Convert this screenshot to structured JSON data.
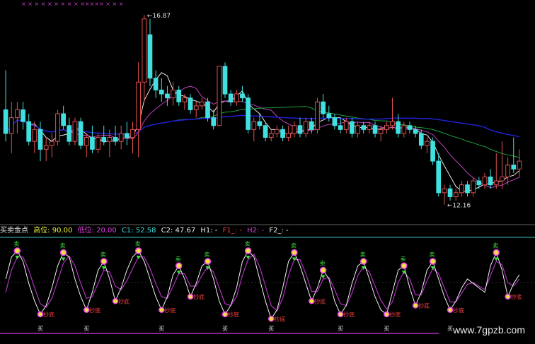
{
  "colors": {
    "background": "#000000",
    "candle_up": "#e05050",
    "candle_down": "#40e0e0",
    "ma_white": "#e8e8e8",
    "ma_magenta": "#c040c0",
    "ma_green": "#20a040",
    "ma_blue": "#2020d0",
    "kdj_white": "#f0f0f0",
    "kdj_magenta": "#b030c0",
    "grid_cyan": "#40c0c0"
  },
  "top_strip": {
    "x_marks": "×    × ×     × ×  ×  × ×   ×        ×××××   × ×   ×"
  },
  "annotations": {
    "high_label": "16.87",
    "low_label": "12.16"
  },
  "indicator_header": {
    "name": "买卖金点",
    "high_level": "高位: 90.00",
    "low_level": "低位: 20.00",
    "c1": "C1: 52.58",
    "c2": "C2: 47.67",
    "h1": "H1: -",
    "f1": "F1_: -",
    "h2": "H2: -",
    "f2": "F2_: -"
  },
  "signals": {
    "buy_label": "买",
    "sell_label": "卖",
    "bottom_label": "抄底"
  },
  "watermark": "www.7gpzb.com",
  "chart_data": {
    "type": "candlestick",
    "price_range": [
      11.8,
      17.2
    ],
    "candles": [
      [
        14.6,
        15.6,
        13.8,
        14.0
      ],
      [
        14.0,
        14.8,
        13.5,
        14.4
      ],
      [
        14.4,
        14.8,
        14.0,
        14.6
      ],
      [
        14.6,
        14.8,
        14.1,
        14.3
      ],
      [
        14.3,
        14.5,
        13.7,
        13.8
      ],
      [
        13.8,
        14.3,
        13.5,
        14.1
      ],
      [
        14.1,
        14.3,
        13.3,
        13.6
      ],
      [
        13.6,
        13.9,
        13.3,
        13.7
      ],
      [
        13.7,
        14.0,
        13.4,
        13.8
      ],
      [
        13.8,
        14.6,
        13.7,
        14.5
      ],
      [
        14.5,
        14.7,
        14.1,
        14.2
      ],
      [
        14.2,
        14.4,
        13.7,
        13.8
      ],
      [
        13.8,
        14.4,
        13.7,
        14.3
      ],
      [
        14.3,
        14.4,
        13.6,
        13.7
      ],
      [
        13.7,
        14.0,
        13.4,
        13.9
      ],
      [
        13.9,
        14.2,
        13.5,
        13.6
      ],
      [
        13.6,
        14.0,
        13.5,
        13.9
      ],
      [
        13.9,
        14.2,
        13.7,
        13.8
      ],
      [
        13.8,
        14.1,
        13.4,
        13.9
      ],
      [
        13.9,
        14.2,
        13.7,
        13.8
      ],
      [
        13.8,
        14.2,
        13.6,
        14.0
      ],
      [
        14.0,
        14.3,
        13.7,
        13.9
      ],
      [
        13.9,
        14.3,
        13.5,
        14.1
      ],
      [
        14.1,
        15.8,
        13.4,
        15.3
      ],
      [
        15.3,
        17.0,
        14.8,
        16.9
      ],
      [
        16.5,
        16.9,
        15.2,
        15.4
      ],
      [
        15.4,
        15.6,
        14.9,
        15.1
      ],
      [
        15.1,
        15.4,
        14.8,
        15.0
      ],
      [
        15.0,
        15.2,
        14.7,
        14.9
      ],
      [
        14.9,
        15.3,
        14.7,
        15.1
      ],
      [
        15.1,
        15.2,
        14.7,
        14.8
      ],
      [
        14.8,
        15.0,
        14.6,
        14.9
      ],
      [
        14.9,
        15.0,
        14.5,
        14.6
      ],
      [
        14.6,
        14.8,
        14.4,
        14.7
      ],
      [
        14.7,
        14.9,
        14.6,
        14.8
      ],
      [
        14.8,
        14.9,
        14.3,
        14.4
      ],
      [
        14.4,
        14.6,
        14.1,
        14.2
      ],
      [
        14.2,
        15.7,
        14.2,
        15.7
      ],
      [
        15.7,
        15.8,
        14.9,
        15.0
      ],
      [
        15.0,
        15.1,
        14.7,
        14.8
      ],
      [
        14.8,
        15.1,
        14.7,
        15.0
      ],
      [
        15.0,
        15.2,
        14.8,
        14.9
      ],
      [
        14.9,
        15.0,
        14.0,
        14.1
      ],
      [
        14.1,
        14.4,
        13.8,
        14.3
      ],
      [
        14.3,
        14.5,
        14.1,
        14.2
      ],
      [
        14.2,
        14.3,
        13.8,
        13.9
      ],
      [
        13.9,
        14.1,
        13.8,
        14.0
      ],
      [
        14.0,
        14.2,
        13.9,
        14.1
      ],
      [
        14.1,
        14.2,
        13.8,
        13.9
      ],
      [
        13.9,
        14.2,
        13.8,
        14.0
      ],
      [
        14.0,
        14.3,
        13.9,
        14.2
      ],
      [
        14.2,
        14.4,
        13.9,
        14.0
      ],
      [
        14.0,
        14.4,
        13.9,
        14.3
      ],
      [
        14.3,
        14.4,
        14.0,
        14.1
      ],
      [
        14.1,
        14.9,
        14.0,
        14.8
      ],
      [
        14.8,
        15.0,
        14.4,
        14.5
      ],
      [
        14.5,
        14.7,
        14.3,
        14.4
      ],
      [
        14.4,
        14.5,
        14.1,
        14.2
      ],
      [
        14.2,
        14.4,
        14.0,
        14.1
      ],
      [
        14.1,
        14.4,
        14.0,
        14.3
      ],
      [
        14.3,
        14.4,
        13.9,
        14.0
      ],
      [
        14.0,
        14.3,
        13.9,
        14.2
      ],
      [
        14.2,
        14.3,
        14.0,
        14.1
      ],
      [
        14.1,
        14.3,
        14.0,
        14.2
      ],
      [
        14.2,
        14.3,
        13.9,
        14.0
      ],
      [
        14.0,
        14.2,
        13.8,
        14.1
      ],
      [
        14.1,
        14.3,
        14.0,
        14.2
      ],
      [
        14.2,
        14.9,
        14.1,
        14.3
      ],
      [
        14.3,
        14.5,
        13.9,
        14.0
      ],
      [
        14.0,
        14.3,
        13.9,
        14.2
      ],
      [
        14.2,
        14.3,
        14.0,
        14.1
      ],
      [
        14.1,
        14.2,
        13.9,
        14.0
      ],
      [
        14.0,
        14.1,
        13.6,
        13.7
      ],
      [
        13.7,
        13.9,
        13.5,
        13.8
      ],
      [
        13.8,
        13.9,
        13.2,
        13.3
      ],
      [
        13.3,
        13.5,
        12.4,
        12.5
      ],
      [
        12.5,
        12.7,
        12.2,
        12.6
      ],
      [
        12.6,
        12.7,
        12.3,
        12.4
      ],
      [
        12.4,
        12.6,
        12.3,
        12.5
      ],
      [
        12.5,
        12.8,
        12.4,
        12.7
      ],
      [
        12.7,
        12.8,
        12.4,
        12.5
      ],
      [
        12.5,
        12.9,
        12.4,
        12.8
      ],
      [
        12.8,
        12.9,
        12.6,
        12.7
      ],
      [
        12.7,
        13.0,
        12.6,
        12.9
      ],
      [
        12.9,
        13.1,
        12.6,
        12.7
      ],
      [
        12.7,
        13.5,
        12.6,
        12.8
      ],
      [
        12.8,
        13.8,
        12.6,
        12.9
      ],
      [
        12.9,
        13.4,
        12.7,
        13.2
      ],
      [
        13.2,
        13.9,
        13.0,
        13.1
      ],
      [
        13.1,
        13.6,
        12.9,
        13.3
      ]
    ],
    "kdj_range": [
      0,
      100
    ],
    "kdj_k": [
      60,
      85,
      92,
      80,
      55,
      35,
      20,
      30,
      50,
      75,
      90,
      85,
      60,
      40,
      25,
      45,
      70,
      80,
      60,
      35,
      50,
      70,
      85,
      92,
      80,
      60,
      40,
      25,
      40,
      65,
      75,
      60,
      40,
      55,
      75,
      80,
      60,
      35,
      20,
      30,
      50,
      80,
      92,
      85,
      60,
      35,
      15,
      25,
      50,
      80,
      90,
      75,
      55,
      35,
      50,
      70,
      60,
      35,
      20,
      30,
      55,
      75,
      80,
      60,
      40,
      25,
      20,
      45,
      70,
      75,
      50,
      30,
      45,
      70,
      80,
      60,
      40,
      25,
      35,
      50,
      60,
      55,
      50,
      45,
      75,
      90,
      70,
      40,
      55,
      65
    ],
    "kdj_d": [
      45,
      70,
      85,
      85,
      70,
      50,
      32,
      28,
      38,
      58,
      78,
      86,
      75,
      55,
      38,
      40,
      55,
      70,
      68,
      52,
      48,
      58,
      72,
      85,
      85,
      72,
      55,
      40,
      38,
      52,
      66,
      66,
      52,
      52,
      64,
      74,
      68,
      50,
      32,
      30,
      40,
      64,
      82,
      88,
      74,
      52,
      30,
      24,
      38,
      64,
      82,
      82,
      66,
      46,
      46,
      60,
      62,
      48,
      32,
      30,
      44,
      64,
      74,
      68,
      52,
      36,
      26,
      34,
      56,
      68,
      60,
      42,
      42,
      58,
      72,
      66,
      50,
      34,
      34,
      44,
      54,
      56,
      52,
      48,
      64,
      80,
      76,
      56,
      52,
      60
    ]
  }
}
